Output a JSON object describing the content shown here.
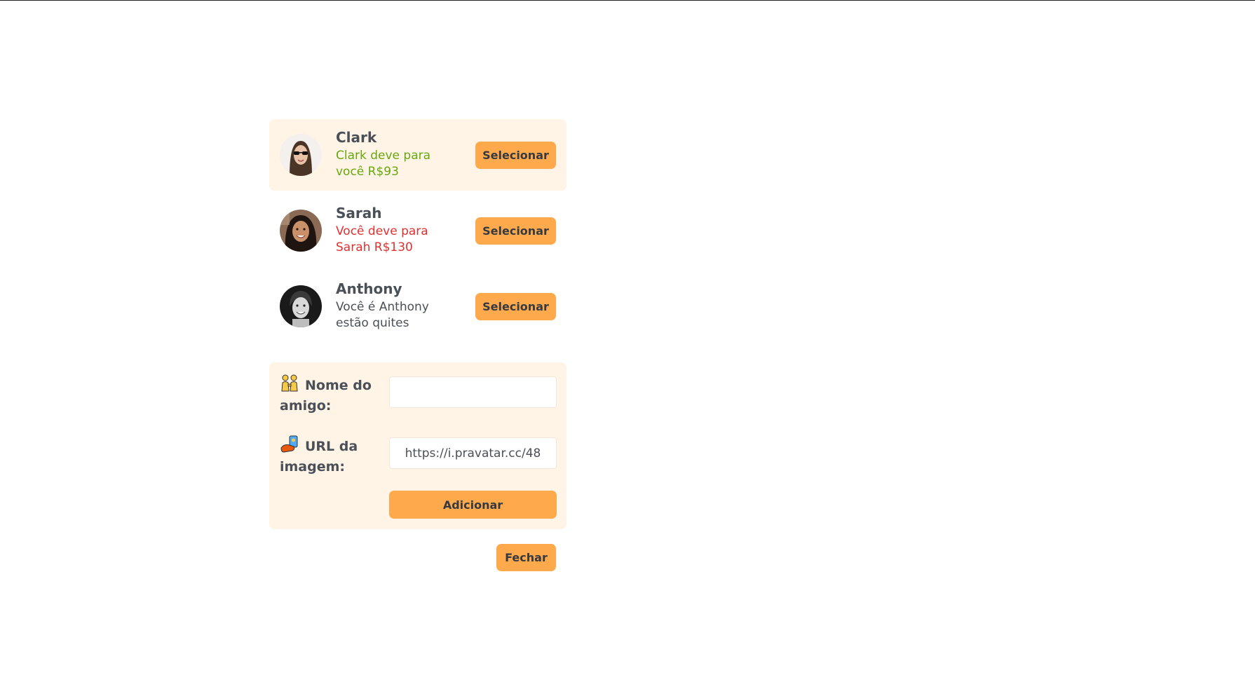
{
  "friends": [
    {
      "name": "Clark",
      "status": "Clark deve para você R$93",
      "status_type": "owes-you",
      "status_color": "#66a80f",
      "selected": true,
      "select_label": "Selecionar"
    },
    {
      "name": "Sarah",
      "status": "Você deve para Sarah R$130",
      "status_type": "you-owe",
      "status_color": "#e03131",
      "selected": false,
      "select_label": "Selecionar"
    },
    {
      "name": "Anthony",
      "status": "Você é Anthony estão quites",
      "status_type": "even",
      "status_color": "#495057",
      "selected": false,
      "select_label": "Selecionar"
    }
  ],
  "add_form": {
    "name_label": "Nome do amigo:",
    "name_icon": "two-people-emoji",
    "name_value": "",
    "url_label": "URL da imagem:",
    "url_icon": "selfie-emoji",
    "url_value": "https://i.pravatar.cc/48",
    "submit_label": "Adicionar"
  },
  "close_label": "Fechar",
  "colors": {
    "accent": "#ffa94d",
    "panel_bg": "#fff4e6",
    "text": "#495057"
  }
}
